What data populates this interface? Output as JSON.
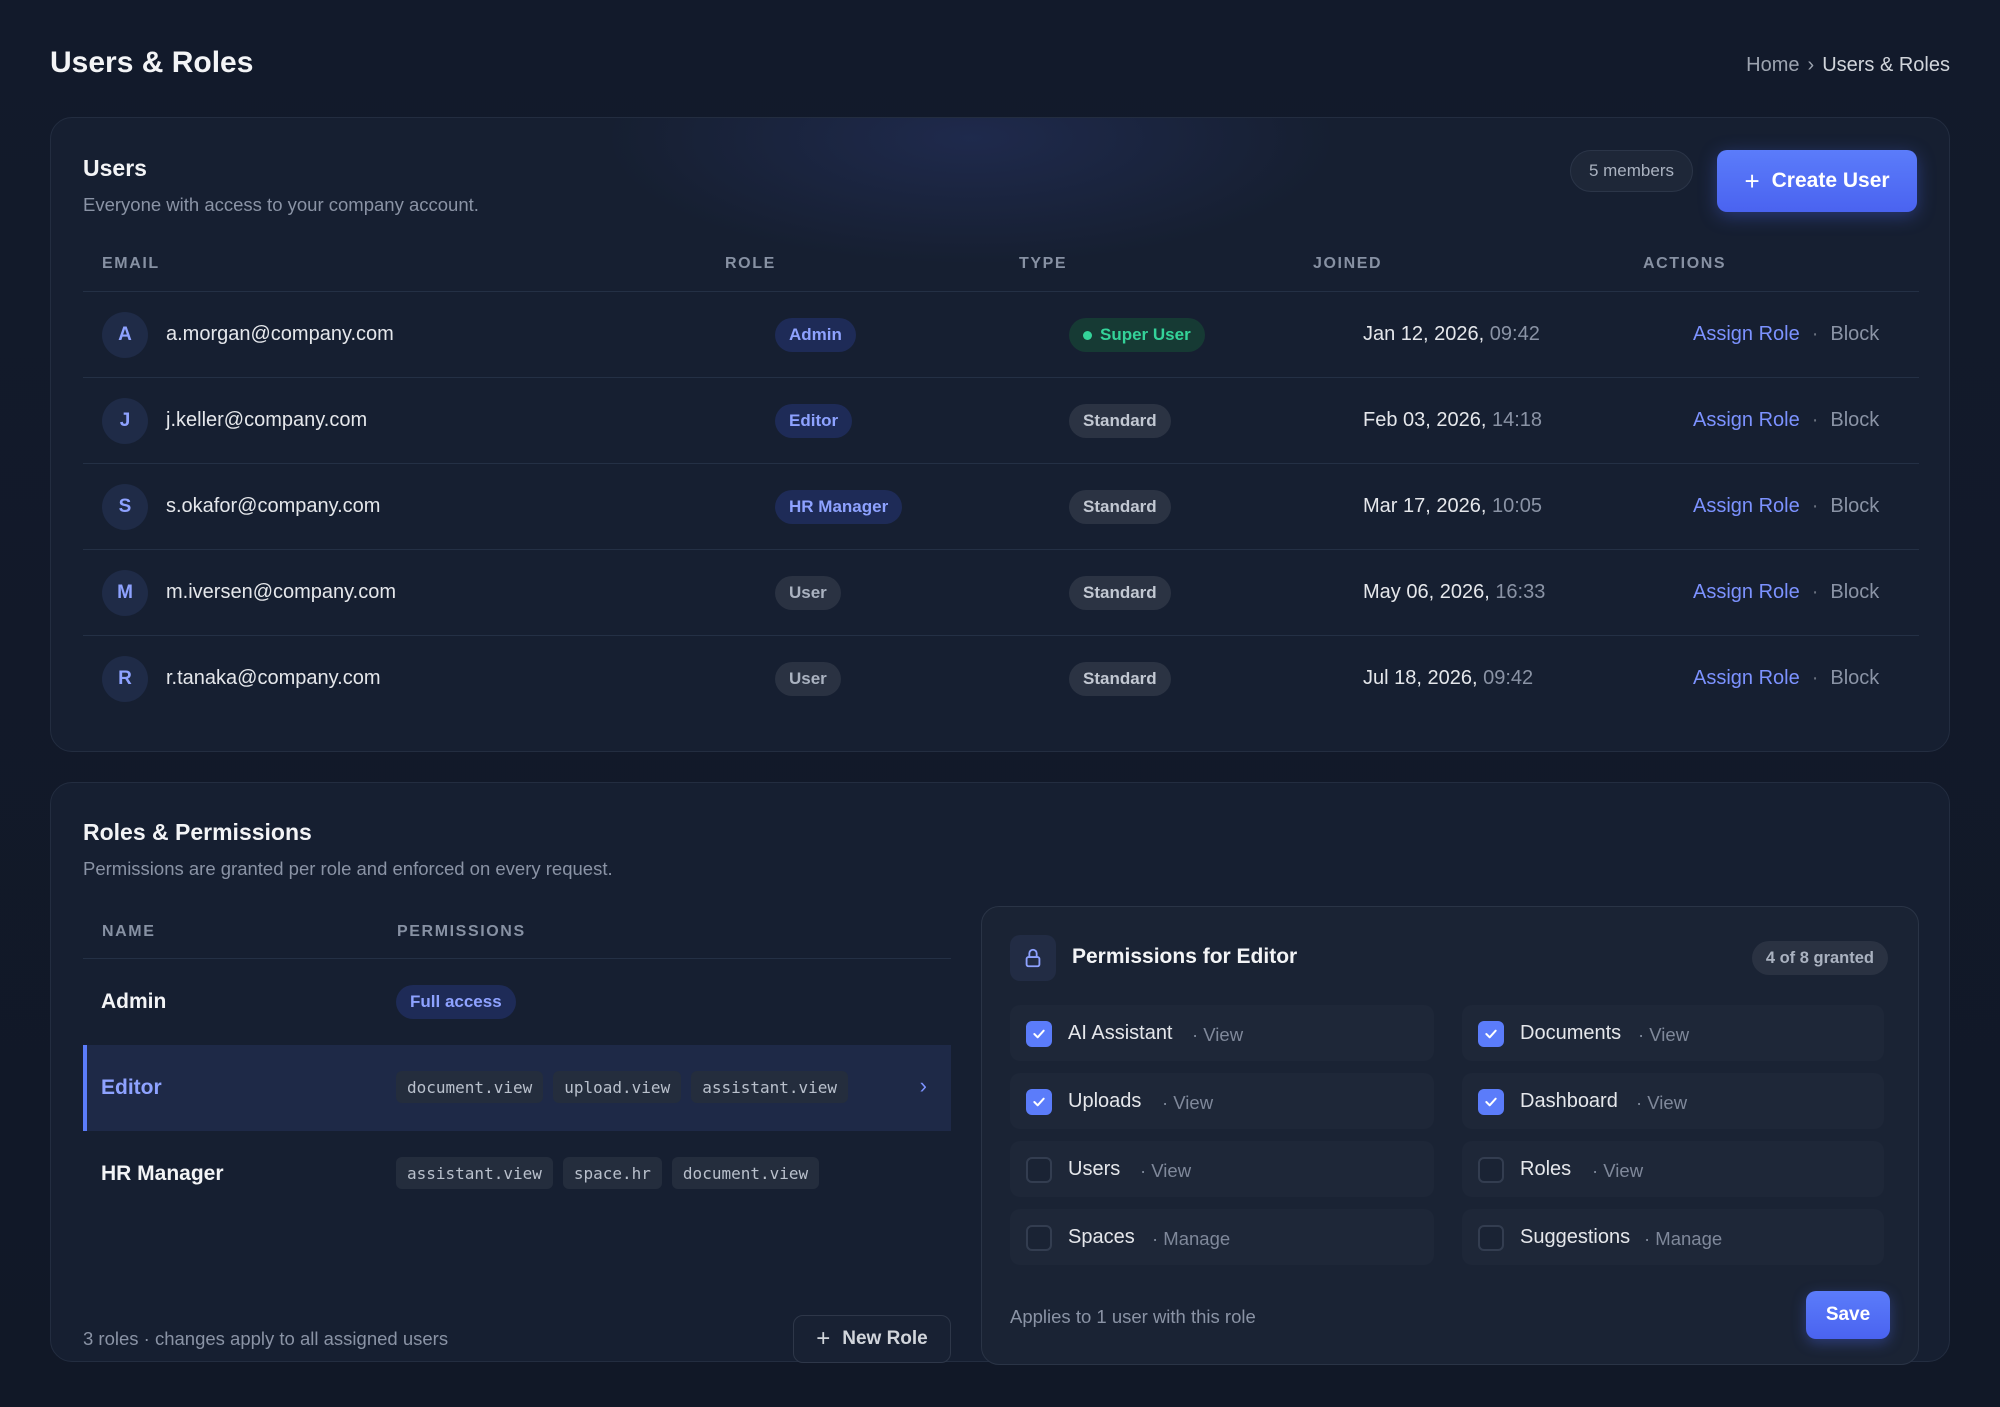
{
  "page": {
    "title": "Users & Roles",
    "breadcrumb": {
      "home": "Home",
      "separator": "›",
      "current": "Users & Roles"
    }
  },
  "users_card": {
    "title": "Users",
    "subtitle": "Everyone with access to your company account.",
    "members_count": "5 members",
    "create_button": "Create User",
    "columns": {
      "email": "EMAIL",
      "role": "ROLE",
      "type": "TYPE",
      "joined": "JOINED",
      "actions": "ACTIONS"
    },
    "rows": [
      {
        "initial": "A",
        "email": "a.morgan@company.com",
        "role": "Admin",
        "type": "Super User",
        "date": "Jan 12, 2026,",
        "time": "09:42",
        "assign": "Assign Role",
        "sep": "·",
        "block": "Block"
      },
      {
        "initial": "J",
        "email": "j.keller@company.com",
        "role": "Editor",
        "type": "Standard",
        "date": "Feb 03, 2026,",
        "time": "14:18",
        "assign": "Assign Role",
        "sep": "·",
        "block": "Block"
      },
      {
        "initial": "S",
        "email": "s.okafor@company.com",
        "role": "HR Manager",
        "type": "Standard",
        "date": "Mar 17, 2026,",
        "time": "10:05",
        "assign": "Assign Role",
        "sep": "·",
        "block": "Block"
      },
      {
        "initial": "M",
        "email": "m.iversen@company.com",
        "role": "User",
        "type": "Standard",
        "date": "May 06, 2026,",
        "time": "16:33",
        "assign": "Assign Role",
        "sep": "·",
        "block": "Block"
      },
      {
        "initial": "R",
        "email": "r.tanaka@company.com",
        "role": "User",
        "type": "Standard",
        "date": "Jul 18, 2026,",
        "time": "09:42",
        "assign": "Assign Role",
        "sep": "·",
        "block": "Block"
      }
    ]
  },
  "roles_card": {
    "title": "Roles & Permissions",
    "subtitle": "Permissions are granted per role and enforced on every request.",
    "columns": {
      "name": "NAME",
      "permissions": "PERMISSIONS"
    },
    "roles": [
      {
        "name": "Admin",
        "full_access": "Full access"
      },
      {
        "name": "Editor",
        "chips": [
          "document.view",
          "upload.view",
          "assistant.view"
        ],
        "chevron": "›"
      },
      {
        "name": "HR Manager",
        "chips": [
          "assistant.view",
          "space.hr",
          "document.view"
        ]
      }
    ],
    "footer": "3 roles · changes apply to all assigned users",
    "new_role_button": "New Role"
  },
  "permissions_panel": {
    "title": "Permissions for Editor",
    "granted": "4 of 8 granted",
    "items": [
      {
        "label": "AI Assistant",
        "scope": "· View",
        "checked": true
      },
      {
        "label": "Documents",
        "scope": "· View",
        "checked": true
      },
      {
        "label": "Uploads",
        "scope": "· View",
        "checked": true
      },
      {
        "label": "Dashboard",
        "scope": "· View",
        "checked": true
      },
      {
        "label": "Users",
        "scope": "· View",
        "checked": false
      },
      {
        "label": "Roles",
        "scope": "· View",
        "checked": false
      },
      {
        "label": "Spaces",
        "scope": "· Manage",
        "checked": false
      },
      {
        "label": "Suggestions",
        "scope": "· Manage",
        "checked": false
      }
    ],
    "footer": "Applies to 1 user with this role",
    "save_button": "Save"
  },
  "colors": {
    "accent": "#5b7cfa",
    "success": "#34d399",
    "background": "#111827",
    "card": "#161f31"
  }
}
